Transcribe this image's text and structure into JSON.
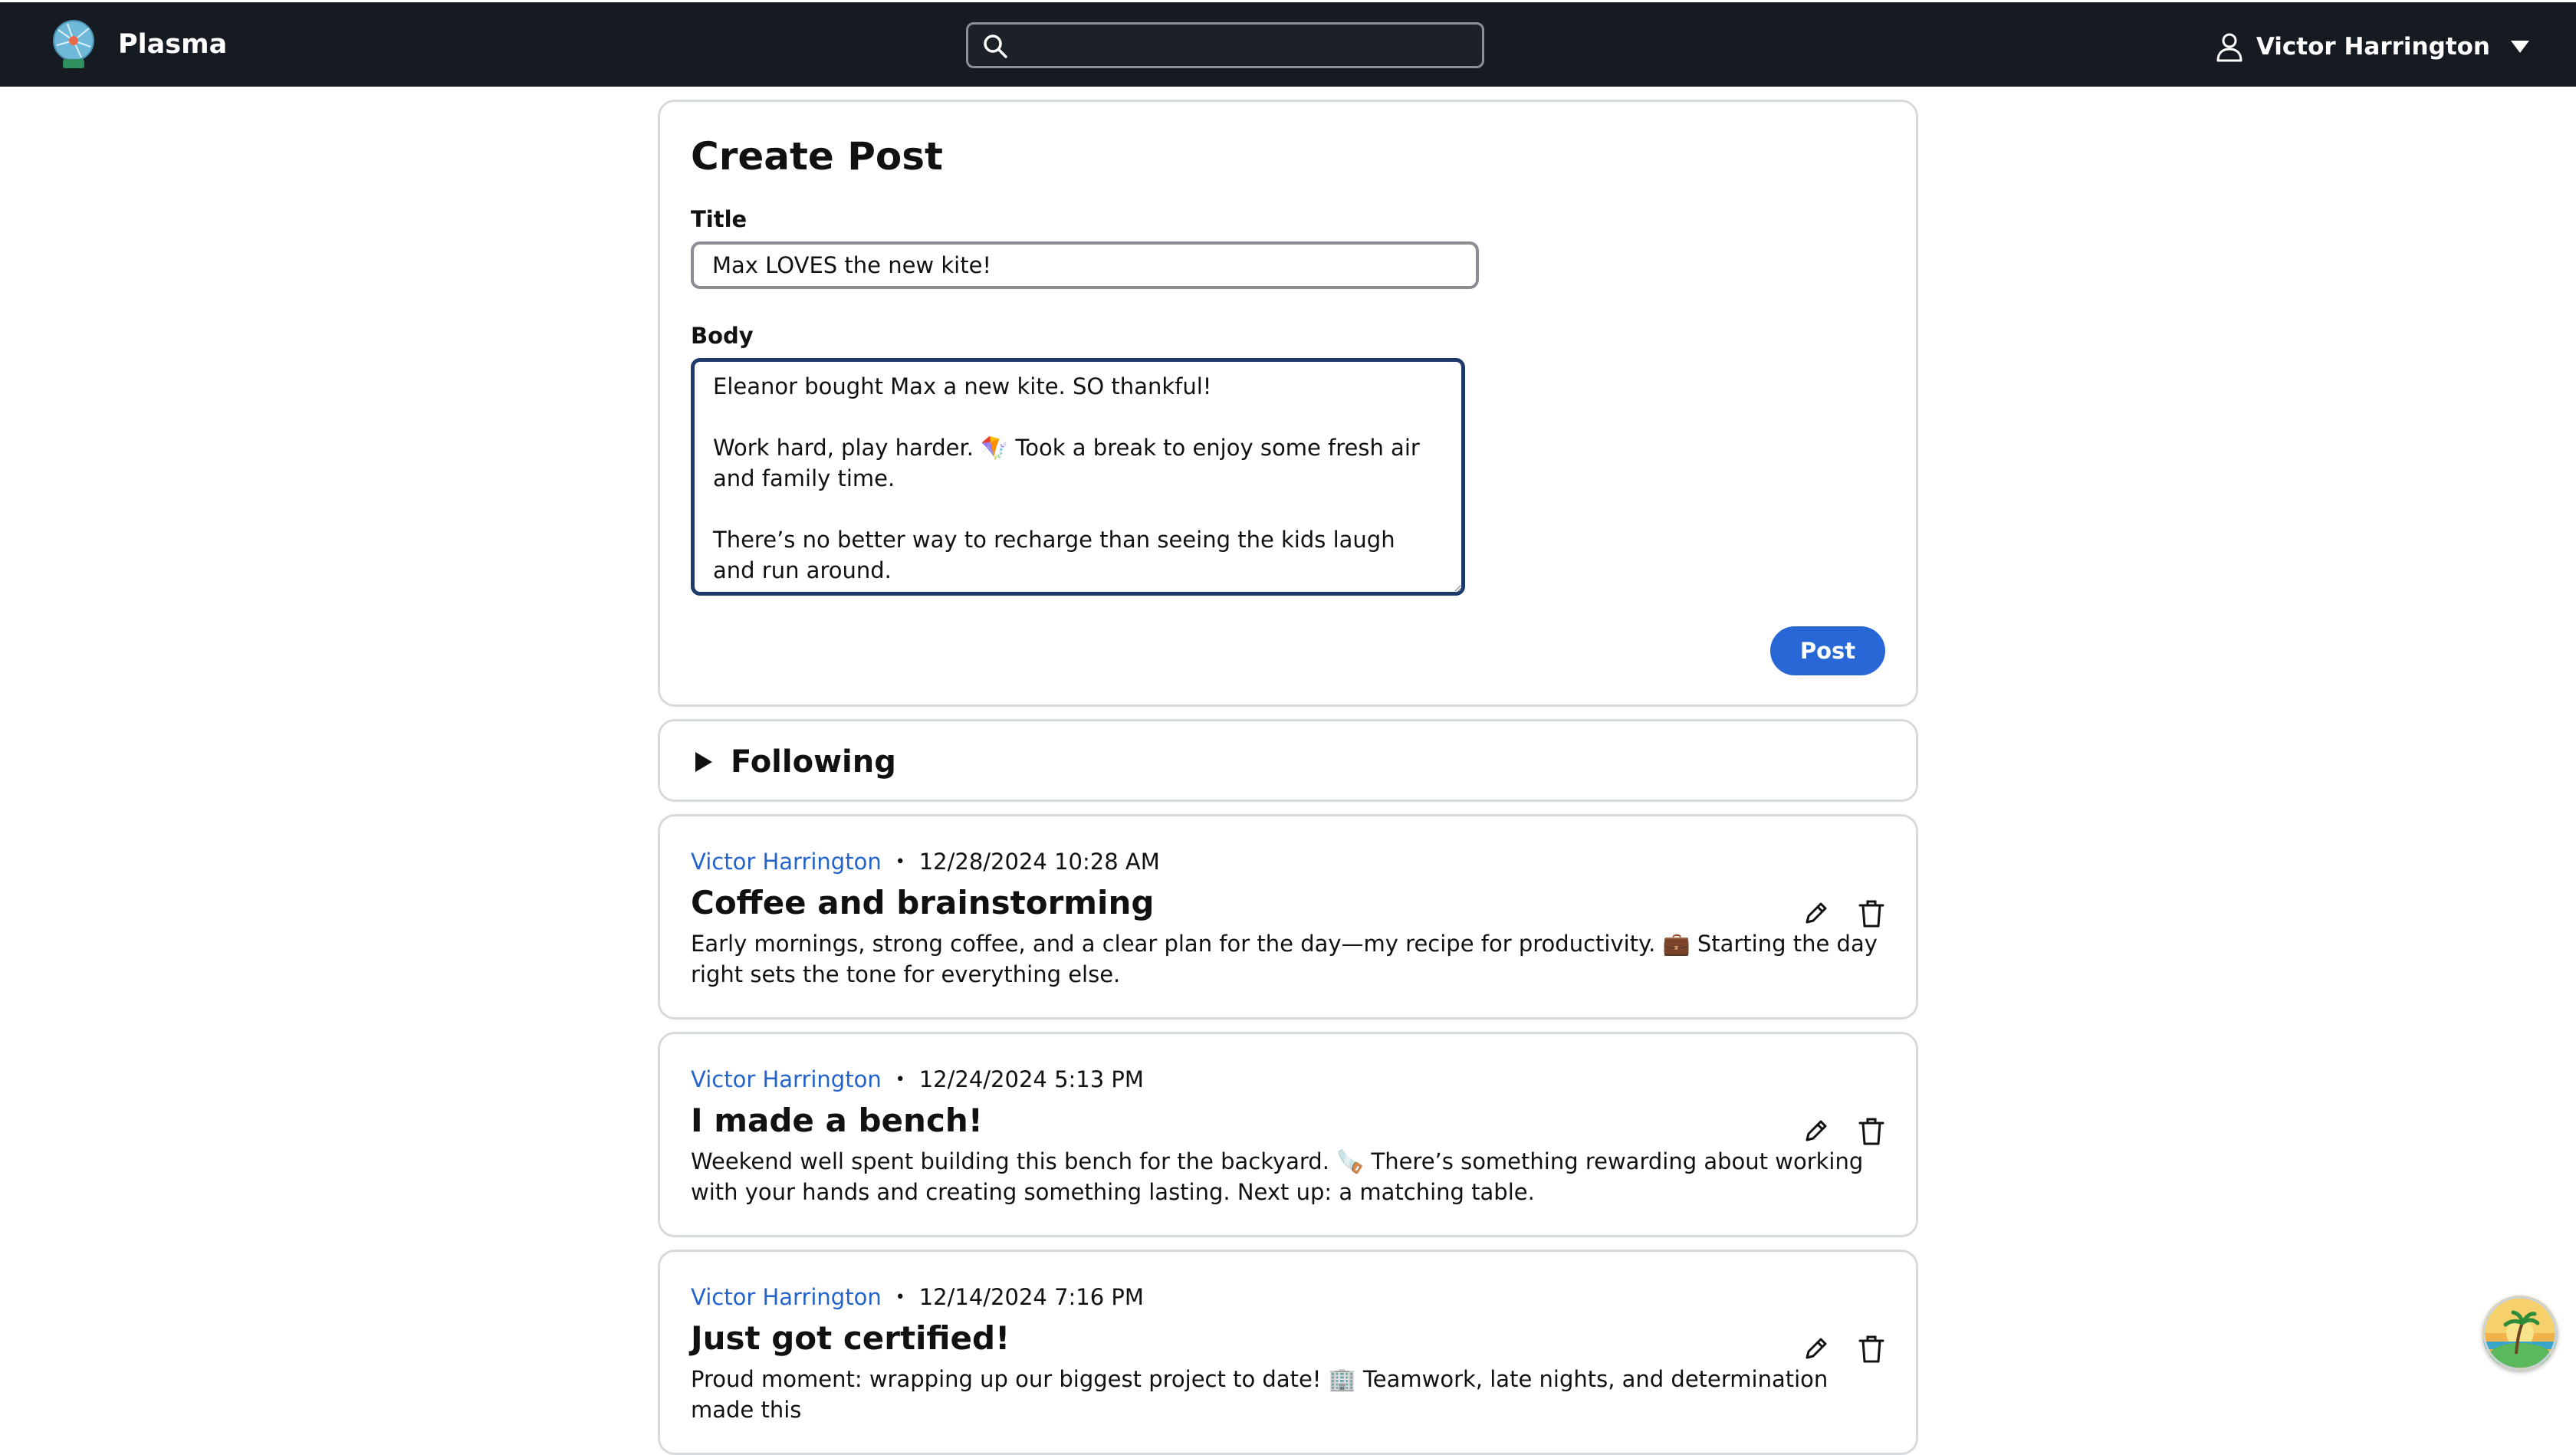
{
  "app": {
    "name": "Plasma"
  },
  "search": {
    "placeholder": "",
    "value": ""
  },
  "user": {
    "name": "Victor Harrington"
  },
  "create_post": {
    "heading": "Create Post",
    "title_label": "Title",
    "title_value": "Max LOVES the new kite!",
    "body_label": "Body",
    "body_value": "Eleanor bought Max a new kite. SO thankful!\n\nWork hard, play harder. 🪁 Took a break to enjoy some fresh air and family time.\n\nThere’s no better way to recharge than seeing the kids laugh and run around.",
    "submit_label": "Post"
  },
  "following": {
    "label": "Following",
    "expanded": false
  },
  "posts": [
    {
      "author": "Victor Harrington",
      "separator": "•",
      "timestamp": "12/28/2024 10:28 AM",
      "title": "Coffee and brainstorming",
      "body": "Early mornings, strong coffee, and a clear plan for the day—my recipe for productivity. 💼 Starting the day right sets the tone for everything else."
    },
    {
      "author": "Victor Harrington",
      "separator": "•",
      "timestamp": "12/24/2024 5:13 PM",
      "title": "I made a bench!",
      "body": "Weekend well spent building this bench for the backyard. 🪚 There’s something rewarding about working with your hands and creating something lasting. Next up: a matching table."
    },
    {
      "author": "Victor Harrington",
      "separator": "•",
      "timestamp": "12/14/2024 7:16 PM",
      "title": "Just got certified!",
      "body": "Proud moment: wrapping up our biggest project to date! 🏢 Teamwork, late nights, and determination made this"
    }
  ],
  "icons": {
    "logo": "plasma-globe-logo",
    "search": "search-icon",
    "user": "user-icon",
    "caret": "caret-down-icon",
    "expand": "triangle-right-icon",
    "edit": "pencil-icon",
    "delete": "trash-icon",
    "assistant": "island-avatar-icon"
  },
  "colors": {
    "navbar": "#161b22",
    "accent": "#2767d6",
    "link": "#2463c9",
    "card_border": "#d7dadd",
    "focus_border": "#1d3a6b"
  }
}
